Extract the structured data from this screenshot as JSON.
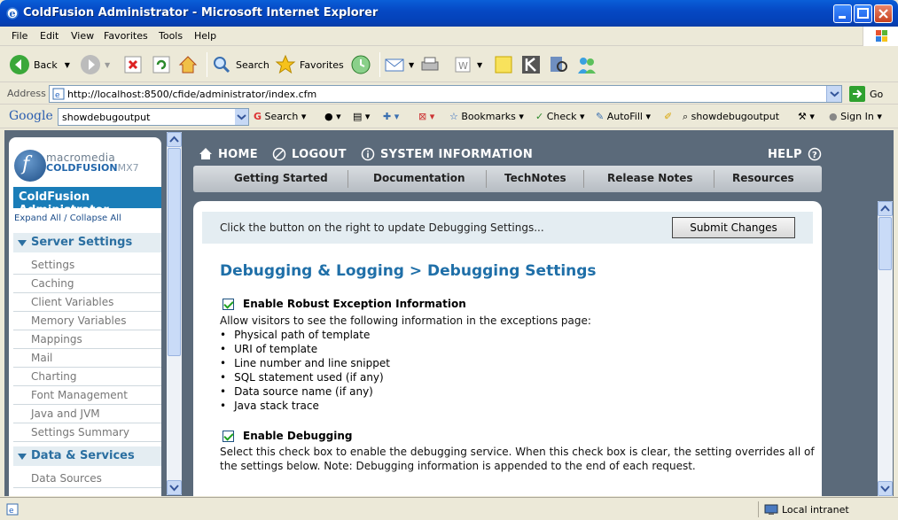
{
  "window": {
    "title": "ColdFusion Administrator - Microsoft Internet Explorer"
  },
  "menu": [
    "File",
    "Edit",
    "View",
    "Favorites",
    "Tools",
    "Help"
  ],
  "toolbar": {
    "back": "Back",
    "search": "Search",
    "favorites": "Favorites"
  },
  "address": {
    "label": "Address",
    "url": "http://localhost:8500/cfide/administrator/index.cfm",
    "go": "Go"
  },
  "google": {
    "logo": "Google",
    "query": "showdebugoutput",
    "search": "Search",
    "bookmarks": "Bookmarks",
    "check": "Check",
    "autofill": "AutoFill",
    "term": "showdebugoutput",
    "signin": "Sign In"
  },
  "sidebar": {
    "brand_small": "macromedia",
    "brand": "COLDFUSION",
    "brand_ver": "MX7",
    "title": "ColdFusion Administrator",
    "expand": "Expand All / Collapse All",
    "section1": "Server Settings",
    "items": [
      "Settings",
      "Caching",
      "Client Variables",
      "Memory Variables",
      "Mappings",
      "Mail",
      "Charting",
      "Font Management",
      "Java and JVM",
      "Settings Summary"
    ],
    "section2": "Data & Services",
    "items2": [
      "Data Sources"
    ]
  },
  "nav": {
    "home": "HOME",
    "logout": "LOGOUT",
    "sysinfo": "SYSTEM INFORMATION",
    "help": "HELP"
  },
  "tabs": [
    "Getting Started",
    "Documentation",
    "TechNotes",
    "Release Notes",
    "Resources"
  ],
  "main": {
    "notice": "Click the button on the right to update Debugging Settings...",
    "submit": "Submit Changes",
    "title": "Debugging & Logging > Debugging Settings",
    "opt1": {
      "label": "Enable Robust Exception Information",
      "desc": "Allow visitors to see the following information in the exceptions page:",
      "bullets": [
        "Physical path of template",
        "URI of template",
        "Line number and line snippet",
        "SQL statement used (if any)",
        "Data source name (if any)",
        "Java stack trace"
      ]
    },
    "opt2": {
      "label": "Enable Debugging",
      "desc1": "Select this check box to enable the debugging service. When this check box is clear, the setting overrides all of",
      "desc2": "the settings below. Note: Debugging information is appended to the end of each request."
    }
  },
  "status": {
    "zone": "Local intranet"
  }
}
